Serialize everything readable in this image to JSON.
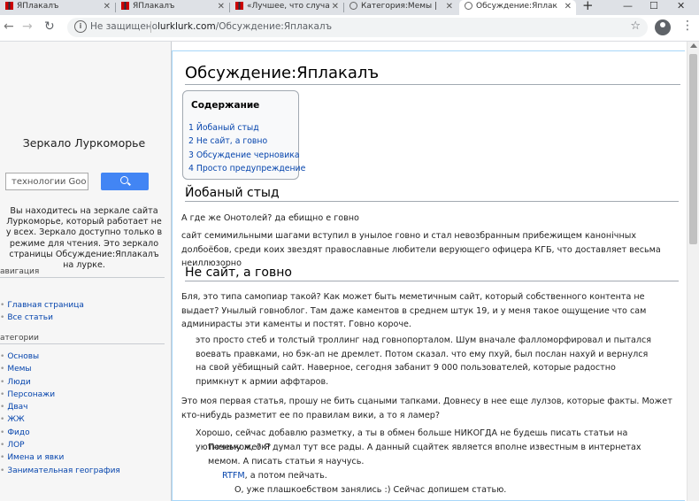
{
  "browser": {
    "tabs": [
      {
        "title": "ЯПлакалъ",
        "active": false
      },
      {
        "title": "ЯПлакалъ",
        "active": false
      },
      {
        "title": "«Лучшее, что случа",
        "active": false
      },
      {
        "title": "Категория:Мемы | ",
        "active": false
      },
      {
        "title": "Обсуждение:Яплак",
        "active": true
      }
    ],
    "new_tab": "+",
    "security_label": "Не защищено",
    "url_host": "lurklurk.com",
    "url_path": "/Обсуждение:Яплакалъ",
    "win_min": "—",
    "win_max": "☐",
    "win_close": "✕"
  },
  "sidebar": {
    "site_name": "Зеркало Луркоморье",
    "search_placeholder": "технологии Goo",
    "mirror_note": "Вы находитесь на зеркале сайта Луркоморье, который работает не у всех. Зеркало доступно только в режиме для чтения. Это зеркало страницы Обсуждение:Яплакалъ на лурке.",
    "navigation_heading": "авигация",
    "navigation_items": [
      "Главная страница",
      "Все статьи"
    ],
    "categories_heading": "атегории",
    "category_items": [
      "Основы",
      "Мемы",
      "Люди",
      "Персонажи",
      "Двач",
      "ЖЖ",
      "Фидо",
      "ЛОР",
      "Имена и явки",
      "Занимательная география"
    ]
  },
  "article": {
    "title": "Обсуждение:Яплакалъ",
    "toc_title": "Содержание",
    "toc": [
      "1 Йобаный стыд",
      "2 Не сайт, а говно",
      "3 Обсуждение черновика",
      "4 Просто предупреждение"
    ],
    "section1": {
      "heading": "Йобаный стыд",
      "p1": "А где же Онотолей? да ебищно е говно",
      "p2": "сайт семимильными шагами вступил в унылое говно и стал невозбранным прибежищем канонiчных долбоёбов, среди коих звездят православные любители верующего офицера КГБ, что доставляет весьма неиллюзорно"
    },
    "section2": {
      "heading": "Не сайт, а говно",
      "p1": "Бля, это типа самопиар такой? Как может быть меметичным сайт, который собственного контента не выдает? Унылый говноблог. Там даже каментов в среднем штук 19, и у меня такое ощущение что сам админирасты эти каменты и постят. Говно короче.",
      "reply1": "это просто стеб и толстый троллинг над говнопорталом. Шум вначале фалломорфировал и пытался воевать правками, но бэк-ап не дремлет. Потом сказал. что ему пхуй, был послан нахуй и вернулся на свой уёбищный сайт. Наверное, сегодня забанит 9 000 пользователей, которые радостно примкнут к армии аффтаров.",
      "p2": "Это моя первая статья, прошу не бить сцаными тапками. Довнесу в нее еще лулзов, которые факты. Может кто-нибудь разметит ее по правилам вики, а то я ламер?",
      "reply2": "Хорошо, сейчас добавлю разметку, а ты в обмен больше НИКОГДА не будешь писать статьи на уютненьком, ок?",
      "reply3": "Почему же? Я думал тут все рады. А данный сцайтек является вполне известным в интернетах мемом. А писать статьи я научусь.",
      "reply4_link": "RTFM",
      "reply4_rest": ", а потом пейчать.",
      "reply5": "О, уже плашкоебством занялись :) Сейчас допишем статью."
    }
  },
  "colors": {
    "link": "#0645ad",
    "tabbar": "#dee1e6",
    "sidebar": "#f6f6f6",
    "search_button": "#4285f4"
  }
}
